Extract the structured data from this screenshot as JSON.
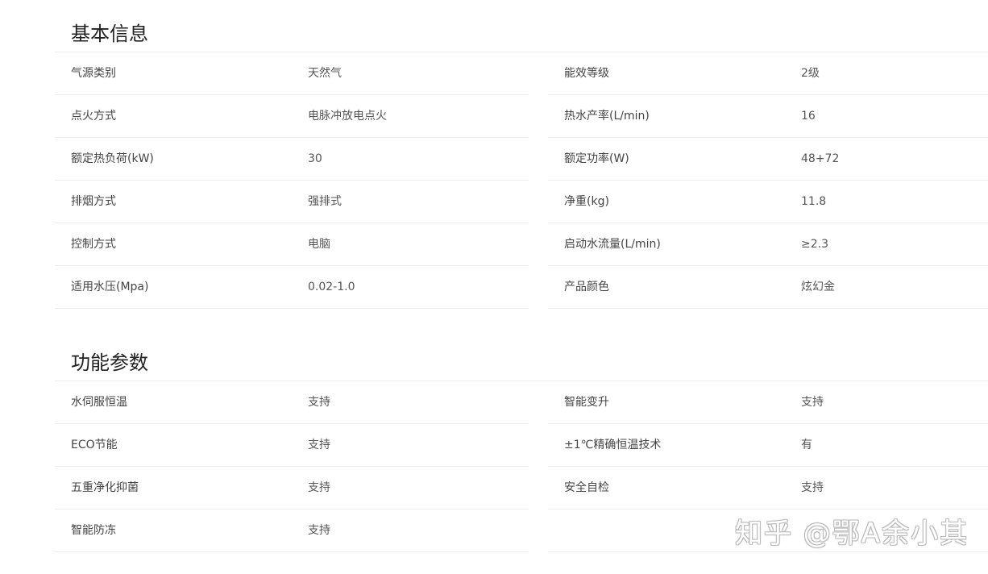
{
  "basic_info": {
    "title": "基本信息",
    "rows": [
      {
        "left_label": "气源类别",
        "left_value": "天然气",
        "right_label": "能效等级",
        "right_value": "2级"
      },
      {
        "left_label": "点火方式",
        "left_value": "电脉冲放电点火",
        "right_label": "热水产率(L/min)",
        "right_value": "16"
      },
      {
        "left_label": "额定热负荷(kW)",
        "left_value": "30",
        "right_label": "额定功率(W)",
        "right_value": "48+72"
      },
      {
        "left_label": "排烟方式",
        "left_value": "强排式",
        "right_label": "净重(kg)",
        "right_value": "11.8"
      },
      {
        "left_label": "控制方式",
        "left_value": "电脑",
        "right_label": "启动水流量(L/min)",
        "right_value": "≥2.3"
      },
      {
        "left_label": "适用水压(Mpa)",
        "left_value": "0.02-1.0",
        "right_label": "产品颜色",
        "right_value": "炫幻金"
      }
    ]
  },
  "functions": {
    "title": "功能参数",
    "rows": [
      {
        "left_label": "水伺服恒温",
        "left_value": "支持",
        "right_label": "智能变升",
        "right_value": "支持"
      },
      {
        "left_label": "ECO节能",
        "left_value": "支持",
        "right_label": "±1℃精确恒温技术",
        "right_value": "有"
      },
      {
        "left_label": "五重净化抑菌",
        "left_value": "支持",
        "right_label": "安全自检",
        "right_value": "支持"
      },
      {
        "left_label": "智能防冻",
        "left_value": "支持",
        "right_label": "",
        "right_value": ""
      }
    ]
  },
  "watermark": "知乎 @鄂A余小其"
}
